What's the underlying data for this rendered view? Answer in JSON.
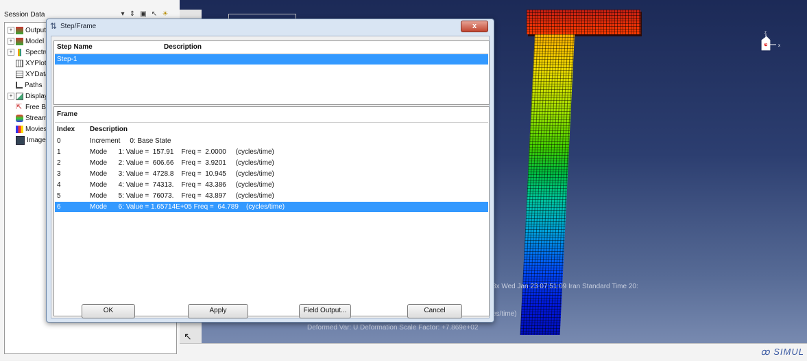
{
  "session": {
    "title": "Session Data",
    "items": [
      {
        "label": "Output",
        "expandable": true
      },
      {
        "label": "Model",
        "expandable": true
      },
      {
        "label": "Spectru",
        "expandable": true
      },
      {
        "label": "XYPlot",
        "expandable": false
      },
      {
        "label": "XYData",
        "expandable": false
      },
      {
        "label": "Paths",
        "expandable": false
      },
      {
        "label": "Display",
        "expandable": true
      },
      {
        "label": "Free Bo",
        "expandable": false
      },
      {
        "label": "Stream",
        "expandable": false
      },
      {
        "label": "Movies",
        "expandable": false
      },
      {
        "label": "Images",
        "expandable": false
      }
    ]
  },
  "dialog": {
    "title": "Step/Frame",
    "close_label": "x",
    "steps": {
      "headers": {
        "name": "Step Name",
        "description": "Description"
      },
      "rows": [
        {
          "name": "Step-1",
          "description": "",
          "selected": true
        }
      ]
    },
    "frames": {
      "section_label": "Frame",
      "headers": {
        "index": "Index",
        "description": "Description"
      },
      "rows": [
        {
          "index": "0",
          "description": "Increment     0: Base State",
          "selected": false
        },
        {
          "index": "1",
          "description": "Mode      1: Value =  157.91    Freq =  2.0000     (cycles/time)",
          "selected": false
        },
        {
          "index": "2",
          "description": "Mode      2: Value =  606.66    Freq =  3.9201     (cycles/time)",
          "selected": false
        },
        {
          "index": "3",
          "description": "Mode      3: Value =  4728.8    Freq =  10.945     (cycles/time)",
          "selected": false
        },
        {
          "index": "4",
          "description": "Mode      4: Value =  74313.    Freq =  43.386     (cycles/time)",
          "selected": false
        },
        {
          "index": "5",
          "description": "Mode      5: Value =  76073.    Freq =  43.897     (cycles/time)",
          "selected": false
        },
        {
          "index": "6",
          "description": "Mode      6: Value = 1.65714E+05 Freq =  64.789    (cycles/time)",
          "selected": true
        }
      ]
    },
    "buttons": {
      "ok": "OK",
      "apply": "Apply",
      "field_output": "Field Output...",
      "cancel": "Cancel"
    }
  },
  "viewport": {
    "timestamp": "3x    Wed Jan 23 07:51:09 Iran Standard Time 20:",
    "freq_unit": "es/time)",
    "deformation": "Deformed Var: U   Deformation Scale Factor: +7.869e+02",
    "brand": "SIMUL",
    "axis_z": "z",
    "axis_x": "x"
  },
  "colors": {
    "selection": "#3399ff",
    "contour_max": "#ff2a00",
    "contour_min": "#0010c0",
    "viewport_bg_top": "#1c2a57",
    "viewport_bg_bottom": "#788ab0"
  }
}
